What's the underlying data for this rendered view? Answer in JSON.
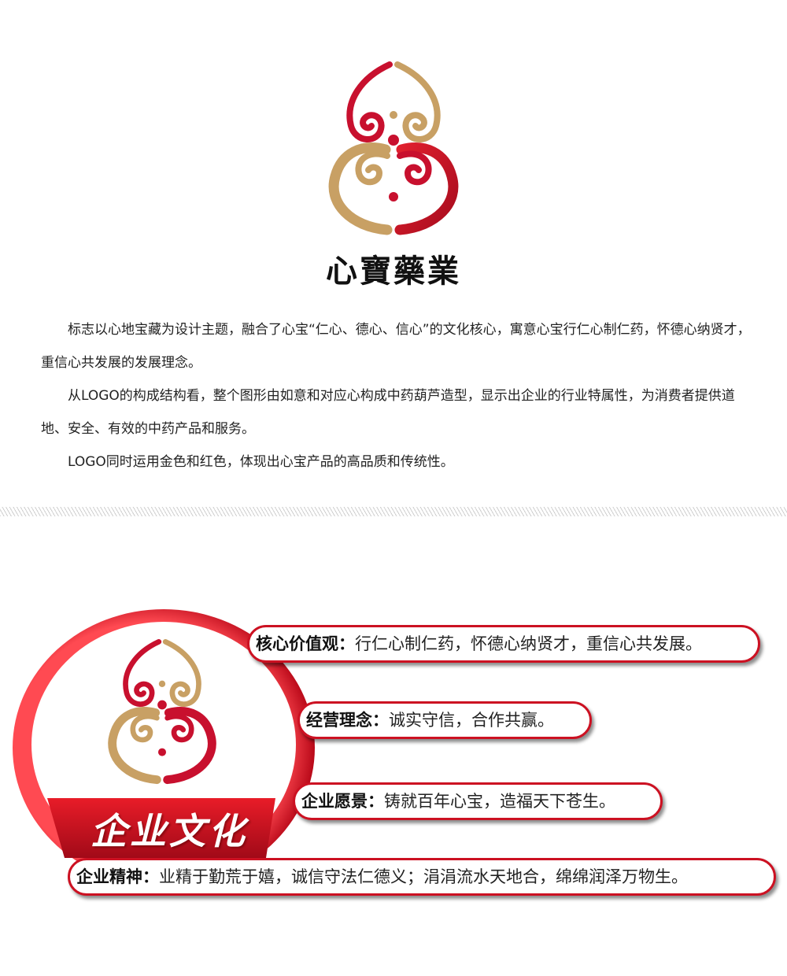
{
  "brand": {
    "name": "心寶藥業",
    "colors": {
      "gold": "#c8a064",
      "red": "#c8102e"
    }
  },
  "intro": {
    "paragraphs": [
      "标志以心地宝藏为设计主题，融合了心宝“仁心、德心、信心”的文化核心，寓意心宝行仁心制仁药，怀德心纳贤才，重信心共发展的发展理念。",
      "从LOGO的构成结构看，整个图形由如意和对应心构成中药葫芦造型，显示出企业的行业特属性，为消费者提供道地、安全、有效的中药产品和服务。",
      "LOGO同时运用金色和红色，体现出心宝产品的高品质和传统性。"
    ]
  },
  "culture": {
    "title": "企业文化",
    "items": [
      {
        "label": "核心价值观：",
        "value": "行仁心制仁药，怀德心纳贤才，重信心共发展。"
      },
      {
        "label": "经营理念：",
        "value": "诚实守信，合作共赢。"
      },
      {
        "label": "企业愿景：",
        "value": "铸就百年心宝，造福天下苍生。"
      },
      {
        "label": "企业精神：",
        "value": "业精于勤荒于嬉，诚信守法仁德义；涓涓流水天地合，绵绵润泽万物生。"
      }
    ]
  }
}
